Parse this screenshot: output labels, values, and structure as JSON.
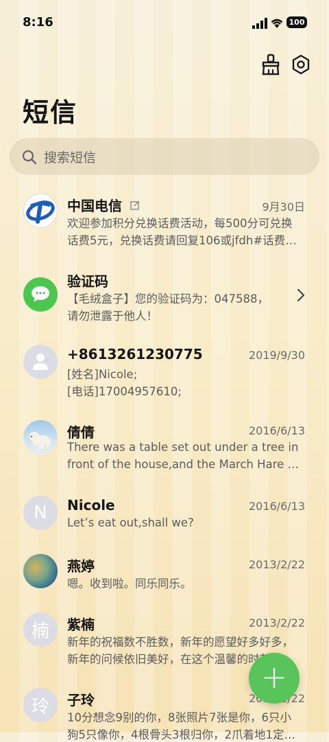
{
  "status_bar": {
    "time": "8:16",
    "battery": "100"
  },
  "header": {
    "title": "短信",
    "icons": [
      "brush-icon",
      "gear-icon"
    ]
  },
  "search": {
    "placeholder": "搜索短信"
  },
  "messages": [
    {
      "name": "中国电信",
      "date": "9月30日",
      "line1": "欢迎参加积分兑换话费活动，每500分可兑换",
      "line2": "话费5元，兑换话费请回复106或jfdh#话费…",
      "avatar": "china-telecom-logo"
    },
    {
      "name": "验证码",
      "date": "",
      "line1": "【毛绒盒子】您的验证码为：047588，",
      "line2": "请勿泄露于他人！",
      "avatar": "message-bubble-icon"
    },
    {
      "name": "+8613261230775",
      "date": "2019/9/30",
      "line1": "[姓名]Nicole;",
      "line2": "[电话]17004957610;",
      "avatar": "person-icon"
    },
    {
      "name": "倩倩",
      "date": "2016/6/13",
      "line1": "There was a table set out under a tree in",
      "line2": "front of the house,and the March Hare an…",
      "avatar": "polar-bear-photo"
    },
    {
      "name": "Nicole",
      "date": "2016/6/13",
      "line1": "Let’s eat out,shall we?",
      "line2": "",
      "avatar_letter": "N"
    },
    {
      "name": "燕婷",
      "date": "2013/2/22",
      "line1": "嗯。收到啦。同乐同乐。",
      "line2": "",
      "avatar": "landscape-photo"
    },
    {
      "name": "紫楠",
      "date": "2013/2/22",
      "line1": "新年的祝福数不胜数，新年的愿望好多好多，",
      "line2": "新年的问候依旧美好，在这个温馨的时刻…",
      "avatar_letter": "楠"
    },
    {
      "name": "子玲",
      "date": "2013/2/22",
      "line1": "10分想念9别的你，8张照片7张是你，6只小",
      "line2": "狗5只像你，4根骨头3根归你，2爪着地1定…",
      "avatar_letter": "玲"
    }
  ],
  "fab": {
    "label": "+"
  },
  "colors": {
    "accent": "#58c45a",
    "telecom_blue": "#1c5fb8"
  }
}
